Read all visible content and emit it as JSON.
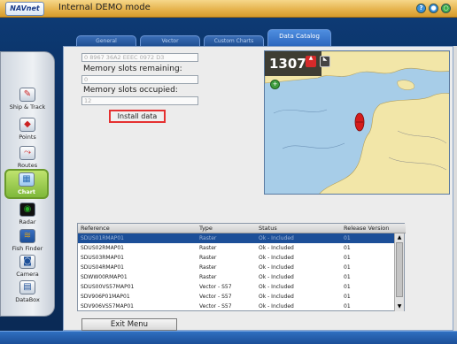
{
  "window": {
    "logo": "NAVnet",
    "title": "Internal DEMO mode"
  },
  "tabs": [
    {
      "label": "General"
    },
    {
      "label": "Vector"
    },
    {
      "label": "Custom Charts"
    },
    {
      "label": "Data Catalog"
    }
  ],
  "sidebar": {
    "items": [
      {
        "label": "Ship & Track",
        "icon": "ship-track-icon"
      },
      {
        "label": "Points",
        "icon": "points-icon"
      },
      {
        "label": "Routes",
        "icon": "routes-icon"
      },
      {
        "label": "Chart",
        "icon": "chart-icon"
      },
      {
        "label": "Radar",
        "icon": "radar-icon"
      },
      {
        "label": "Fish Finder",
        "icon": "fish-finder-icon"
      },
      {
        "label": "Camera",
        "icon": "camera-icon"
      },
      {
        "label": "DataBox",
        "icon": "databox-icon"
      }
    ]
  },
  "info": {
    "system_id": "0 8967 36A2 EEEC 0972 D3",
    "slots_remaining_label": "Memory slots remaining:",
    "slots_remaining_value": "0",
    "slots_occupied_label": "Memory slots occupied:",
    "slots_occupied_value": "12",
    "install_label": "Install data"
  },
  "map": {
    "counter": "1307",
    "zoom_button": "+"
  },
  "table": {
    "headers": [
      "Reference",
      "Type",
      "Status",
      "Release Version"
    ],
    "rows": [
      {
        "reference": "SDUS01RMAP01",
        "type": "Raster",
        "status": "Ok - Included",
        "version": "01"
      },
      {
        "reference": "SDUS02RMAP01",
        "type": "Raster",
        "status": "Ok - Included",
        "version": "01"
      },
      {
        "reference": "SDUS03RMAP01",
        "type": "Raster",
        "status": "Ok - Included",
        "version": "01"
      },
      {
        "reference": "SDUS04RMAP01",
        "type": "Raster",
        "status": "Ok - Included",
        "version": "01"
      },
      {
        "reference": "SDWW00RMAP01",
        "type": "Raster",
        "status": "Ok - Included",
        "version": "01"
      },
      {
        "reference": "SDUS00VS57MAP01",
        "type": "Vector - S57",
        "status": "Ok - Included",
        "version": "01"
      },
      {
        "reference": "SDV906P01MAP01",
        "type": "Vector - S57",
        "status": "Ok - Included",
        "version": "01"
      },
      {
        "reference": "SDV906VS57MAP01",
        "type": "Vector - S57",
        "status": "Ok - Included",
        "version": "01"
      }
    ]
  },
  "exit_label": "Exit Menu",
  "colors": {
    "accent": "#2c66bd",
    "title_bar": "#e6b44f",
    "active_sidebar": "#7fb83a",
    "highlight_border": "#e53030"
  }
}
